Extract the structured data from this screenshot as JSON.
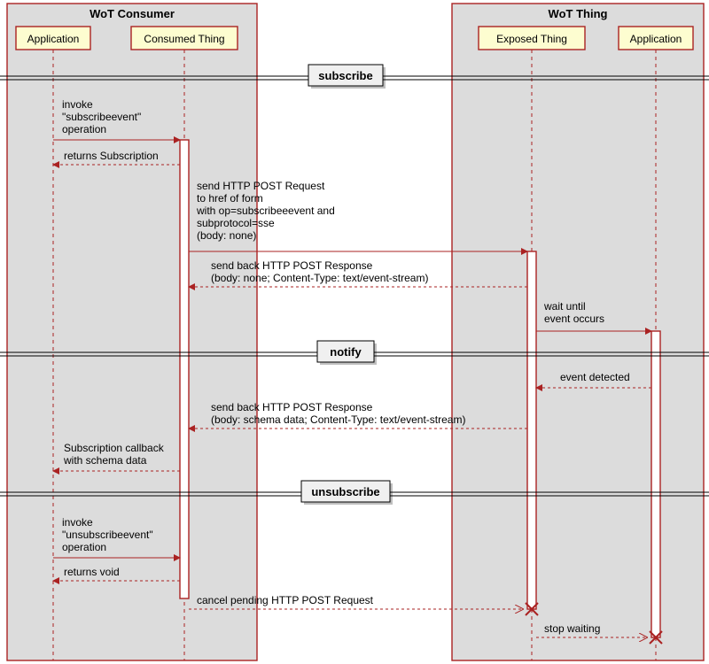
{
  "chart_data": {
    "type": "sequence-diagram",
    "boxes": [
      {
        "name": "WoT Consumer",
        "lifelines": [
          "Application",
          "Consumed Thing"
        ]
      },
      {
        "name": "WoT Thing",
        "lifelines": [
          "Exposed Thing",
          "Application"
        ]
      }
    ],
    "sections": [
      {
        "divider": "subscribe",
        "messages": [
          {
            "from": "Consumer.Application",
            "to": "Consumer.Consumed Thing",
            "text": "invoke\n\"subscribeevent\"\noperation",
            "kind": "sync"
          },
          {
            "from": "Consumer.Consumed Thing",
            "to": "Consumer.Application",
            "text": "returns Subscription",
            "kind": "return"
          },
          {
            "from": "Consumer.Consumed Thing",
            "to": "Thing.Exposed Thing",
            "text": "send HTTP POST Request\nto href of form\n  with op=subscribeeevent and\n  subprotocol=sse\n  (body: none)",
            "kind": "sync"
          },
          {
            "from": "Thing.Exposed Thing",
            "to": "Consumer.Consumed Thing",
            "text": "send back HTTP POST Response\n  (body: none; Content-Type: text/event-stream)",
            "kind": "return"
          },
          {
            "from": "Thing.Exposed Thing",
            "to": "Thing.Application",
            "text": "wait until\nevent occurs",
            "kind": "sync"
          }
        ]
      },
      {
        "divider": "notify",
        "messages": [
          {
            "from": "Thing.Application",
            "to": "Thing.Exposed Thing",
            "text": "event detected",
            "kind": "return"
          },
          {
            "from": "Thing.Exposed Thing",
            "to": "Consumer.Consumed Thing",
            "text": "send back HTTP POST Response\n  (body: schema data; Content-Type: text/event-stream)",
            "kind": "return"
          },
          {
            "from": "Consumer.Consumed Thing",
            "to": "Consumer.Application",
            "text": "Subscription callback\nwith schema data",
            "kind": "return"
          }
        ]
      },
      {
        "divider": "unsubscribe",
        "messages": [
          {
            "from": "Consumer.Application",
            "to": "Consumer.Consumed Thing",
            "text": "invoke\n\"unsubscribeevent\"\noperation",
            "kind": "sync"
          },
          {
            "from": "Consumer.Consumed Thing",
            "to": "Consumer.Application",
            "text": "returns void",
            "kind": "return"
          },
          {
            "from": "Consumer.Consumed Thing",
            "to": "Thing.Exposed Thing",
            "text": "cancel pending HTTP POST Request",
            "kind": "destroy"
          },
          {
            "from": "Thing.Exposed Thing",
            "to": "Thing.Application",
            "text": "stop waiting",
            "kind": "destroy"
          }
        ]
      }
    ]
  },
  "boxes": {
    "consumer": "WoT Consumer",
    "thing": "WoT Thing"
  },
  "lifelines": {
    "app_c": "Application",
    "consumed": "Consumed Thing",
    "exposed": "Exposed Thing",
    "app_t": "Application"
  },
  "dividers": {
    "subscribe": "subscribe",
    "notify": "notify",
    "unsubscribe": "unsubscribe"
  },
  "msgs": {
    "m1a": "invoke",
    "m1b": "\"subscribeevent\"",
    "m1c": "operation",
    "m2": "returns Subscription",
    "m3a": "send HTTP POST Request",
    "m3b": "to href of form",
    "m3c": "  with op=subscribeeevent and",
    "m3d": "  subprotocol=sse",
    "m3e": "  (body: none)",
    "m4a": "send back HTTP POST Response",
    "m4b": "  (body: none; Content-Type: text/event-stream)",
    "m5a": "wait until",
    "m5b": "event occurs",
    "m6": "event detected",
    "m7a": "send back HTTP POST Response",
    "m7b": "  (body: schema data; Content-Type: text/event-stream)",
    "m8a": "Subscription callback",
    "m8b": "with schema data",
    "m9a": "invoke",
    "m9b": "\"unsubscribeevent\"",
    "m9c": "operation",
    "m10": "returns void",
    "m11": "cancel pending HTTP POST Request",
    "m12": "stop waiting"
  }
}
